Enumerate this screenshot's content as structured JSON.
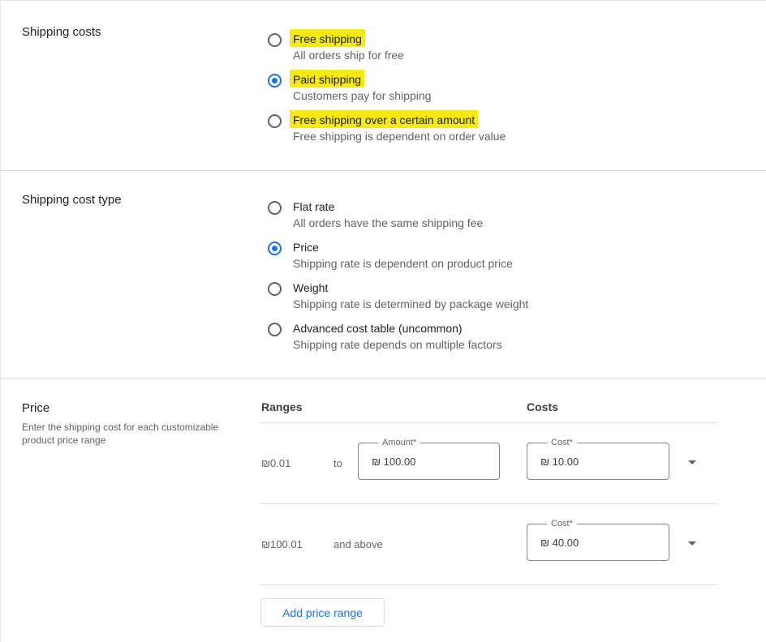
{
  "shipping_costs": {
    "title": "Shipping costs",
    "options": [
      {
        "label": "Free shipping",
        "desc": "All orders ship for free",
        "checked": false,
        "highlighted": true
      },
      {
        "label": "Paid shipping",
        "desc": "Customers pay for shipping",
        "checked": true,
        "highlighted": true
      },
      {
        "label": "Free shipping over a certain amount",
        "desc": "Free shipping is dependent on order value",
        "checked": false,
        "highlighted": true
      }
    ]
  },
  "shipping_cost_type": {
    "title": "Shipping cost type",
    "options": [
      {
        "label": "Flat rate",
        "desc": "All orders have the same shipping fee",
        "checked": false
      },
      {
        "label": "Price",
        "desc": "Shipping rate is dependent on product price",
        "checked": true
      },
      {
        "label": "Weight",
        "desc": "Shipping rate is determined by package weight",
        "checked": false
      },
      {
        "label": "Advanced cost table (uncommon)",
        "desc": "Shipping rate depends on multiple factors",
        "checked": false
      }
    ]
  },
  "price": {
    "title": "Price",
    "desc": "Enter the shipping cost for each customizable product price range",
    "ranges_header": "Ranges",
    "costs_header": "Costs",
    "rows": [
      {
        "from": "₪0.01",
        "connector": "to",
        "amount_label": "Amount*",
        "amount_value": "₪ 100.00",
        "cost_label": "Cost*",
        "cost_value": "₪ 10.00"
      },
      {
        "from": "₪100.01",
        "connector": "and above",
        "cost_label": "Cost*",
        "cost_value": "₪ 40.00"
      }
    ],
    "add_button": "Add price range"
  },
  "colors": {
    "accent": "#1a73e8",
    "highlight": "#f7ea14"
  }
}
